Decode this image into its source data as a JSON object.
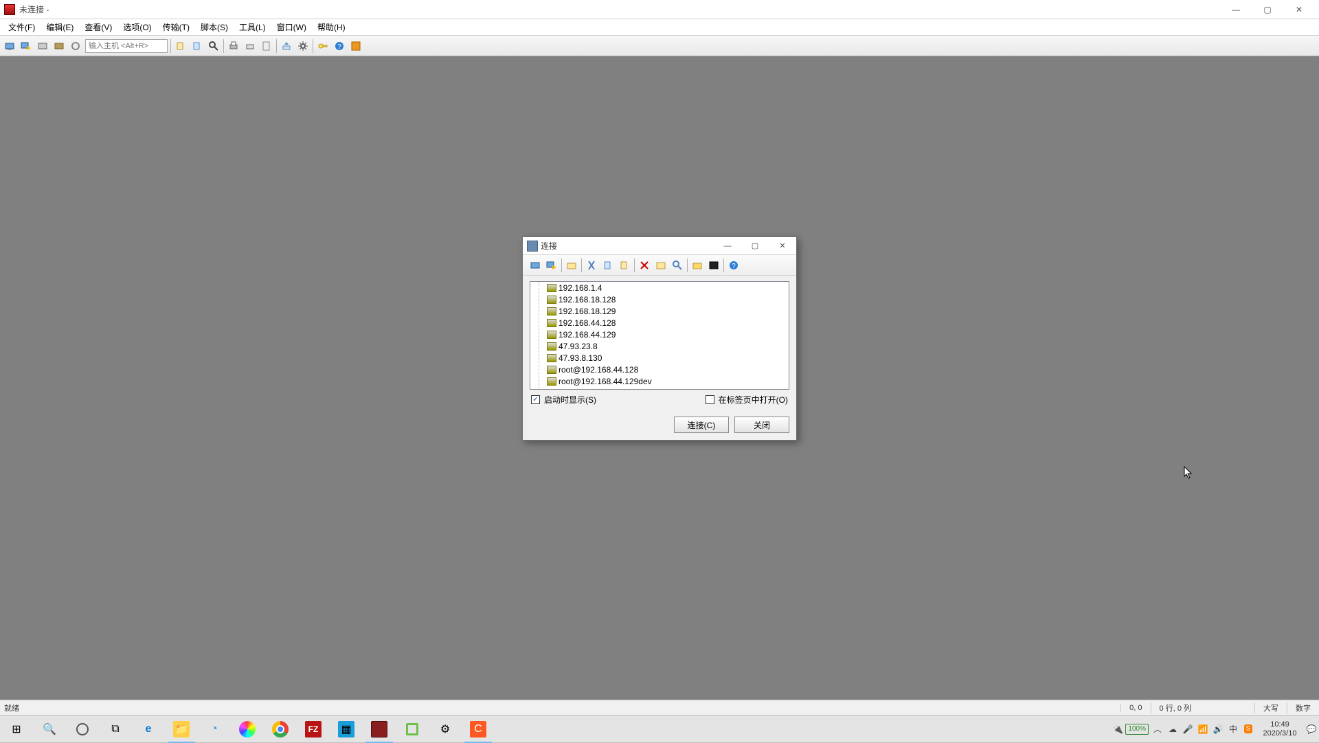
{
  "window": {
    "title": "未连接 -"
  },
  "win_controls": {
    "min": "—",
    "max": "▢",
    "close": "✕"
  },
  "menu": {
    "file": "文件(F)",
    "edit": "编辑(E)",
    "view": "查看(V)",
    "options": "选项(O)",
    "transfer": "传输(T)",
    "script": "脚本(S)",
    "tools": "工具(L)",
    "window": "窗口(W)",
    "help": "帮助(H)"
  },
  "toolbar": {
    "host_placeholder": "输入主机 <Alt+R>"
  },
  "dialog": {
    "title": "连接",
    "win": {
      "min": "—",
      "max": "▢",
      "close": "✕"
    },
    "show_on_start": "启动时显示(S)",
    "open_in_tab": "在标签页中打开(O)",
    "connect": "连接(C)",
    "close": "关闭",
    "servers": [
      "192.168.1.4",
      "192.168.18.128",
      "192.168.18.129",
      "192.168.44.128",
      "192.168.44.129",
      "47.93.23.8",
      "47.93.8.130",
      "root@192.168.44.128",
      "root@192.168.44.129dev"
    ]
  },
  "status": {
    "ready": "就绪",
    "pos": "0, 0",
    "rowcol": "0 行, 0 列",
    "caps": "大写",
    "num": "数字"
  },
  "tray": {
    "battery": "100%",
    "time": "10:49",
    "date": "2020/3/10"
  }
}
